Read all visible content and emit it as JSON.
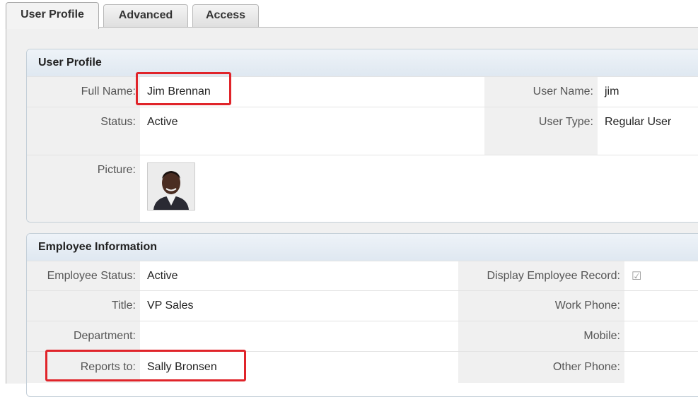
{
  "tabs": [
    "User Profile",
    "Advanced",
    "Access"
  ],
  "user_profile": {
    "heading": "User Profile",
    "full_name_label": "Full Name:",
    "full_name": "Jim Brennan",
    "user_name_label": "User Name:",
    "user_name": "jim",
    "status_label": "Status:",
    "status": "Active",
    "user_type_label": "User Type:",
    "user_type": "Regular User",
    "picture_label": "Picture:"
  },
  "employee": {
    "heading": "Employee Information",
    "emp_status_label": "Employee Status:",
    "emp_status": "Active",
    "display_record_label": "Display Employee Record:",
    "title_label": "Title:",
    "title": "VP Sales",
    "work_phone_label": "Work Phone:",
    "department_label": "Department:",
    "mobile_label": "Mobile:",
    "reports_to_label": "Reports to:",
    "reports_to": "Sally Bronsen",
    "other_phone_label": "Other Phone:"
  },
  "highlight_color": "#e0242a"
}
